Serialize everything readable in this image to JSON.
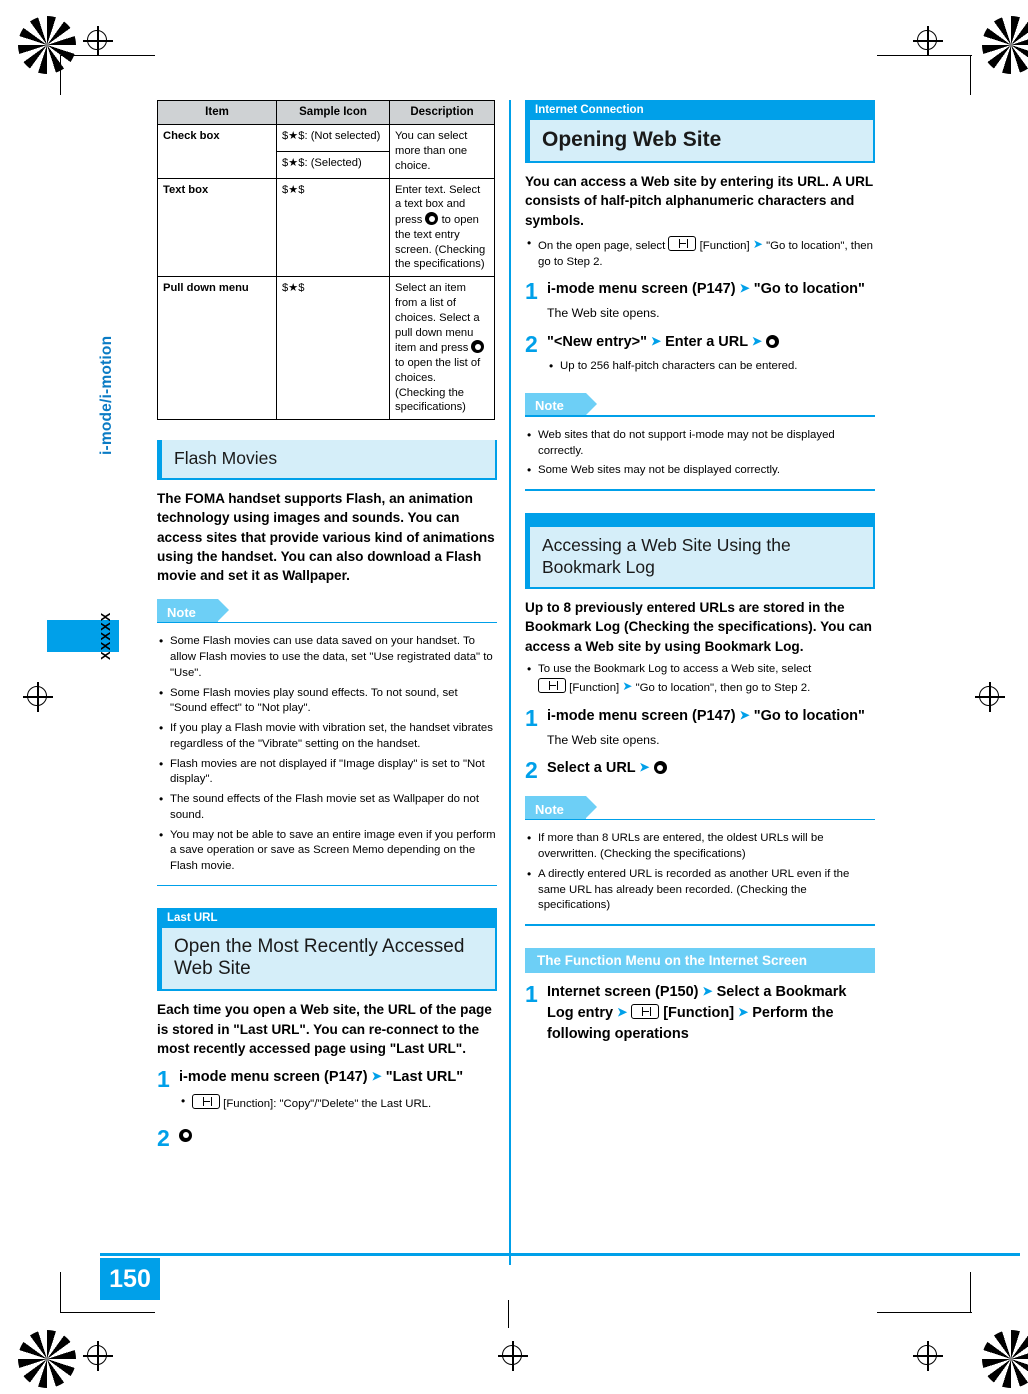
{
  "page": {
    "number": "150",
    "side_label": "i-mode/i-motion",
    "side_code": "XXXXX"
  },
  "left_column": {
    "table": {
      "headers": [
        "Item",
        "Sample Icon",
        "Description"
      ],
      "rows": [
        {
          "item": "Check box",
          "icons": [
            "$★$: (Not selected)",
            "$★$: (Selected)"
          ],
          "description": "You can select more than one choice."
        },
        {
          "item": "Text box",
          "icons": [
            "$★$"
          ],
          "description_pre": "Enter text. Select a text box and press",
          "description_post": "to open the text entry screen. (Checking the specifications)"
        },
        {
          "item": "Pull down menu",
          "icons": [
            "$★$"
          ],
          "description_pre": "Select an item from a list of choices. Select a pull down menu item and press",
          "description_post": "to open the list of choices. (Checking the specifications)"
        }
      ]
    },
    "flash": {
      "heading": "Flash Movies",
      "lead": "The FOMA handset supports Flash, an animation technology using images and sounds.  You can access sites that provide various kind of animations using the handset. You can also download a Flash movie and set it as Wallpaper.",
      "note_label": "Note",
      "notes": [
        "Some Flash movies can use data saved on your handset. To allow Flash movies to use the data, set \"Use registrated data\" to \"Use\".",
        "Some Flash movies play sound effects. To not sound, set \"Sound effect\" to \"Not play\".",
        "If you play a Flash movie with vibration set, the handset vibrates regardless of the \"Vibrate\" setting on the handset.",
        "Flash movies are not displayed if \"Image display\" is set to \"Not display\".",
        "The sound effects of the Flash movie set as Wallpaper do not sound.",
        "You may not be able to save an entire image even if you perform a save operation or save as Screen Memo depending on the Flash movie."
      ]
    },
    "last_url": {
      "tag": "Last URL",
      "heading": "Open the Most Recently Accessed Web Site",
      "lead": "Each time you open a Web site, the URL of the page is stored in \"Last URL\". You can re-connect to the most recently accessed page using \"Last URL\".",
      "step1_num": "1",
      "step1_pre": "i-mode menu screen (P147)",
      "step1_post": "\"Last URL\"",
      "step1_bullet_post": "[Function]: \"Copy\"/\"Delete\" the Last URL.",
      "step2_num": "2"
    }
  },
  "right_column": {
    "internet_connection": {
      "tag": "Internet Connection",
      "heading": "Opening Web Site",
      "lead": "You can access a Web site by entering its URL. A URL consists of half-pitch alphanumeric characters and symbols.",
      "bullet_pre": "On the open page, select",
      "bullet_post": "[Function]",
      "bullet_post2": "\"Go to location\", then go to Step 2.",
      "step1_num": "1",
      "step1_pre": "i-mode menu screen (P147)",
      "step1_post": "\"Go to location\"",
      "step1_sub": "The Web site opens.",
      "step2_num": "2",
      "step2_pre": "\"<New entry>\"",
      "step2_mid": "Enter a URL",
      "step2_bullet": "Up to 256 half-pitch characters can be entered.",
      "note_label": "Note",
      "notes": [
        "Web sites that do not support i-mode may not be displayed correctly.",
        "Some Web sites may not be displayed correctly."
      ]
    },
    "bookmark_log": {
      "heading": "Accessing a Web Site Using the Bookmark Log",
      "lead": "Up to 8 previously entered URLs are stored in the Bookmark Log (Checking the specifications). You can access a Web site by using Bookmark Log.",
      "bullet_pre": "To use the Bookmark Log to access a Web site, select",
      "bullet_post": "[Function]",
      "bullet_post2": "\"Go to location\", then go to Step 2.",
      "step1_num": "1",
      "step1_pre": "i-mode menu screen (P147)",
      "step1_post": "\"Go to location\"",
      "step1_sub": "The Web site opens.",
      "step2_num": "2",
      "step2_text": "Select a URL",
      "note_label": "Note",
      "notes": [
        "If more than 8 URLs are entered, the oldest URLs will be overwritten. (Checking the specifications)",
        "A directly entered URL is recorded as another URL even if the same URL has already been recorded. (Checking the specifications)"
      ]
    },
    "function_menu": {
      "heading": "The Function Menu on the Internet Screen",
      "step1_num": "1",
      "step1_a": "Internet screen (P150)",
      "step1_b": "Select a Bookmark Log entry",
      "step1_c": "[Function]",
      "step1_d": "Perform the following operations"
    }
  },
  "colors": {
    "accent": "#00a0e9",
    "band": "#d5eef9",
    "tab": "#6dcff6",
    "table_header": "#cfd2d4"
  }
}
